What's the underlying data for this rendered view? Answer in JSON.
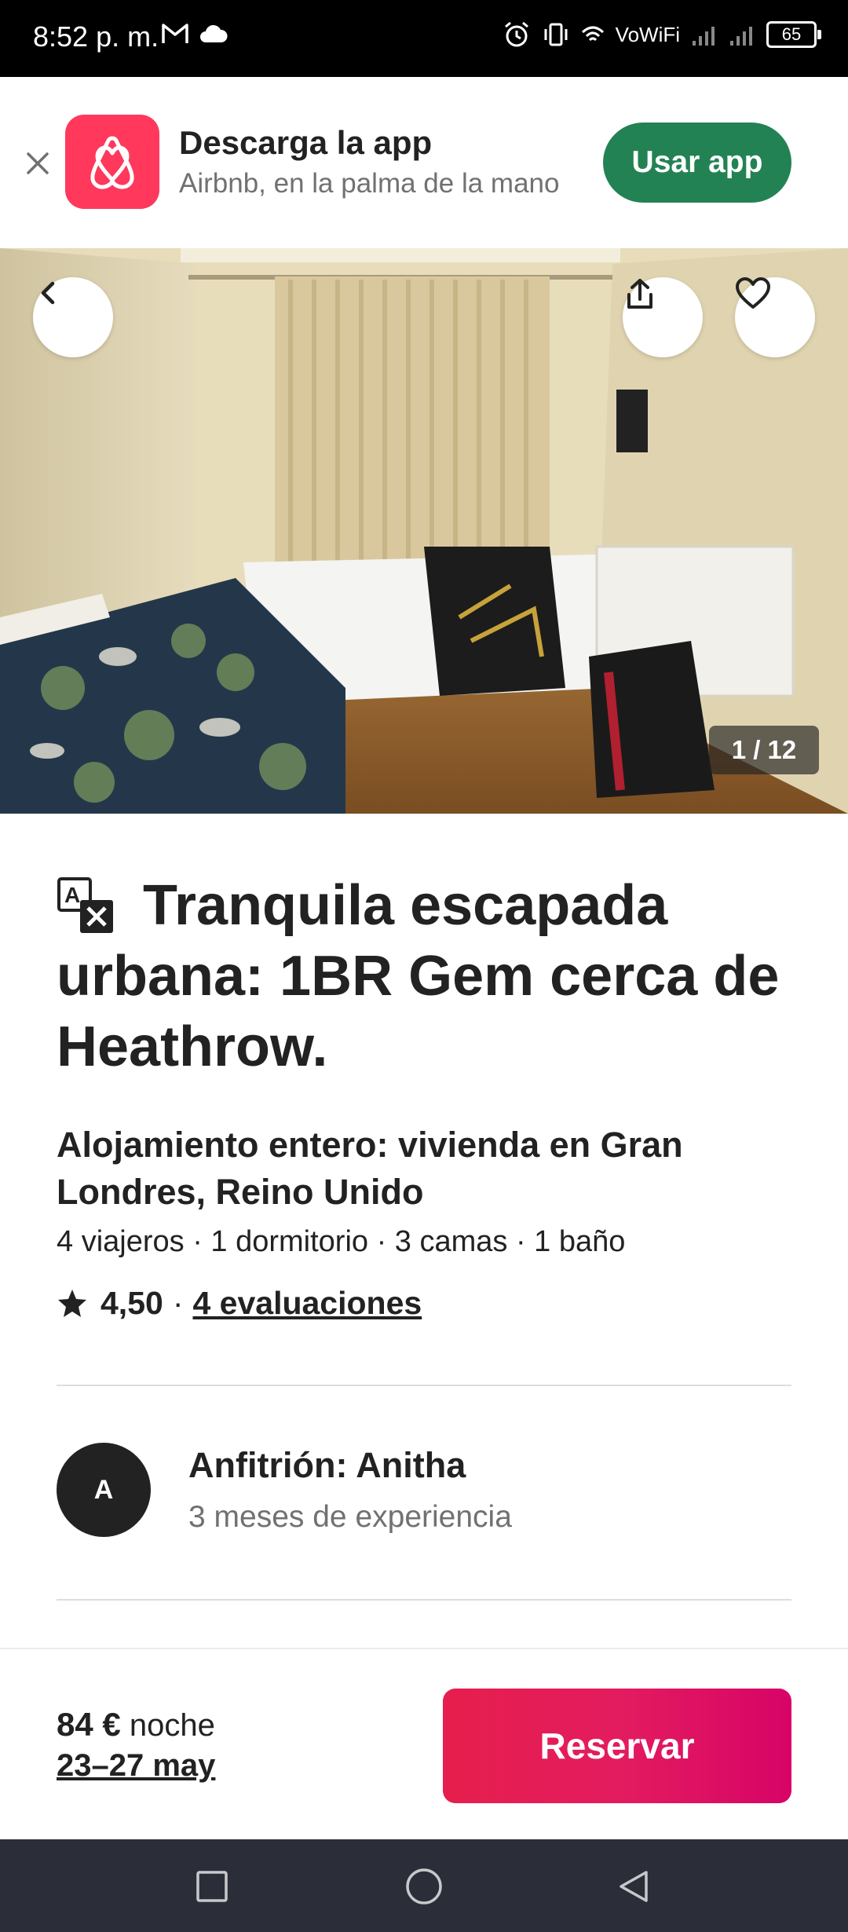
{
  "status_bar": {
    "time": "8:52 p. m.",
    "network_label": "VoWiFi",
    "battery": "65",
    "icons": [
      "gmail-icon",
      "cloud-icon",
      "alarm-icon",
      "vibrate-icon",
      "wifi-icon",
      "signal-icon",
      "signal-icon",
      "battery-icon"
    ]
  },
  "app_banner": {
    "title": "Descarga la app",
    "subtitle": "Airbnb, en la palma de la mano",
    "button_label": "Usar app",
    "logo_icon": "airbnb-logo-icon",
    "close_icon": "close-icon",
    "button_color": "#238254",
    "logo_color": "#FF385C"
  },
  "hero": {
    "photo_counter": "1 / 12",
    "back_icon": "chevron-left-icon",
    "share_icon": "share-icon",
    "save_icon": "heart-icon"
  },
  "listing": {
    "translate_icon": "translate-icon",
    "title": "Tranquila escapada urbana: 1BR Gem cerca de Heathrow.",
    "subtitle": "Alojamiento entero: vivienda en Gran Londres, Reino Unido",
    "details": "4 viajeros · 1 dormitorio · 3 camas · 1 baño",
    "rating": "4,50",
    "rating_separator": "·",
    "reviews": "4 evaluaciones"
  },
  "host": {
    "avatar_initial": "A",
    "name": "Anfitrión: Anitha",
    "experience": "3 meses de experiencia"
  },
  "booking": {
    "price": "84 €",
    "price_unit": "noche",
    "dates": "23–27 may",
    "reserve_label": "Reservar",
    "reserve_color": "#E31C5F"
  },
  "nav_bar": {
    "icons": [
      "recents-square-icon",
      "home-circle-icon",
      "back-triangle-icon"
    ]
  }
}
